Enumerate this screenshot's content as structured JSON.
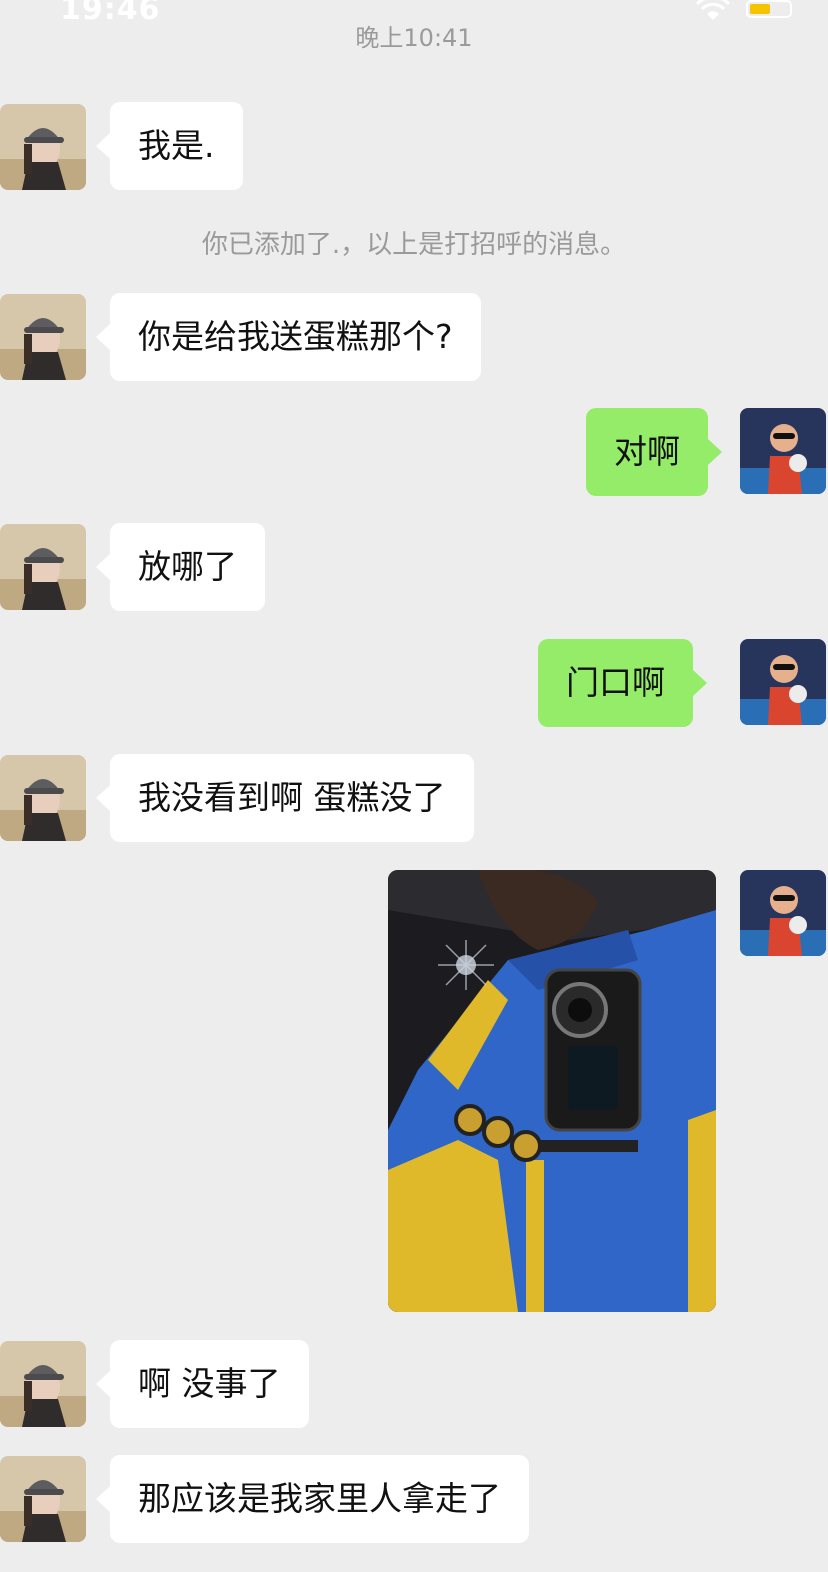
{
  "status_bar": {
    "time": "19:46",
    "icons": [
      "wifi-icon",
      "battery-icon"
    ],
    "battery_color": "#f5c400"
  },
  "chat": {
    "timestamp": "晚上10:41",
    "system_note": "你已添加了.，以上是打招呼的消息。",
    "messages": [
      {
        "side": "left",
        "text": "我是."
      },
      {
        "side": "left",
        "text": "你是给我送蛋糕那个?"
      },
      {
        "side": "right",
        "text": "对啊"
      },
      {
        "side": "left",
        "text": "放哪了"
      },
      {
        "side": "right",
        "text": "门口啊"
      },
      {
        "side": "left",
        "text": "我没看到啊 蛋糕没了"
      },
      {
        "side": "right",
        "type": "image",
        "image_desc": "photo-delivery-jacket-camera"
      },
      {
        "side": "left",
        "text": "啊 没事了"
      },
      {
        "side": "left",
        "text": "那应该是我家里人拿走了"
      }
    ]
  },
  "colors": {
    "background": "#ededed",
    "outgoing_bubble": "#95ec69",
    "incoming_bubble": "#ffffff",
    "meta_text": "#9a9a9a"
  }
}
